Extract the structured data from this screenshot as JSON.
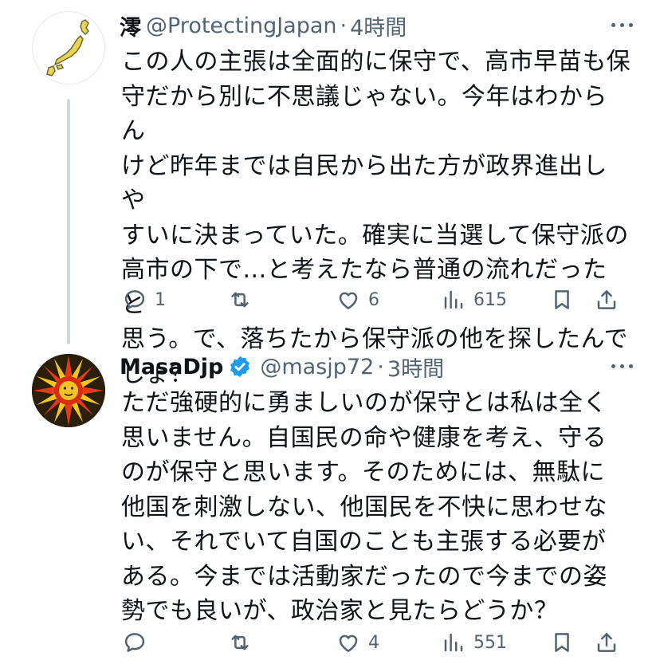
{
  "tweets": [
    {
      "display_name": "澪",
      "handle": "@ProtectingJapan",
      "separator": "·",
      "time": "4時間",
      "verified": false,
      "avatar_icon": "japan-map-icon",
      "text": "この人の主張は全面的に保守で、高市早苗も保\n守だから別に不思議じゃない。今年はわからん\nけど昨年までは自民から出た方が政界進出しや\nすいに決まっていた。確実に当選して保守派の\n高市の下で...と考えたなら普通の流れだったと\n思う。で、落ちたから保守派の他を探したんで\nしょ？",
      "replies": "1",
      "retweets": "",
      "likes": "6",
      "views": "615"
    },
    {
      "display_name": "MasaDjp",
      "handle": "@masjp72",
      "separator": "·",
      "time": "3時間",
      "verified": true,
      "avatar_icon": "sun-face-icon",
      "text": "ただ強硬的に勇ましいのが保守とは私は全く\n思いません。自国民の命や健康を考え、守る\nのが保守と思います。そのためには、無駄に\n他国を刺激しない、他国民を不快に思わせな\nい、それでいて自国のことも主張する必要が\nある。今までは活動家だったので今までの姿\n勢でも良いが、政治家と見たらどうか？",
      "replies": "",
      "retweets": "",
      "likes": "4",
      "views": "551"
    }
  ],
  "colors": {
    "text_primary": "#0f1419",
    "text_secondary": "#536471",
    "verified_blue": "#1d9bf0",
    "thread_line": "#cfd9de"
  },
  "icons": [
    "more-icon",
    "reply-icon",
    "retweet-icon",
    "like-icon",
    "views-icon",
    "bookmark-icon",
    "share-icon",
    "verified-badge-icon"
  ]
}
